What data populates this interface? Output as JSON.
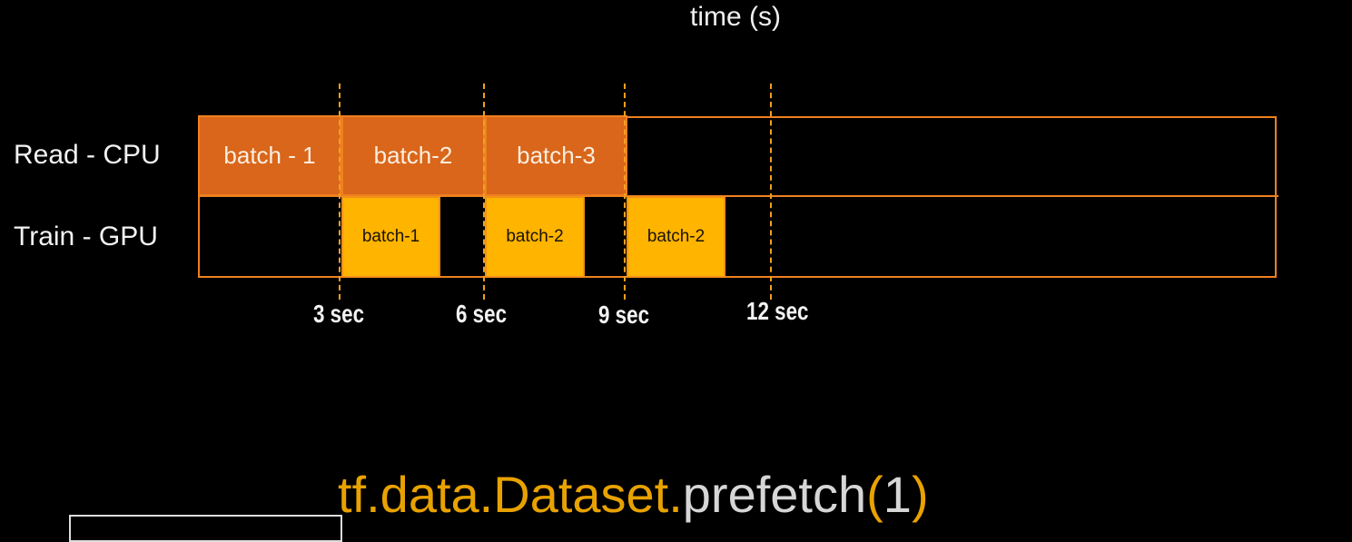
{
  "axis_title": "time (s)",
  "rows": [
    {
      "label": "Read - CPU",
      "blocks": [
        "batch - 1",
        "batch-2",
        "batch-3"
      ]
    },
    {
      "label": "Train - GPU",
      "blocks": [
        "batch-1",
        "batch-2",
        "batch-2"
      ]
    }
  ],
  "ticks": [
    "3 sec",
    "6 sec",
    "9 sec",
    "12 sec"
  ],
  "code": {
    "part1": "tf.data.Dataset.",
    "part2": "prefetch",
    "open": "(",
    "arg": "1",
    "close": ")"
  },
  "colors": {
    "read": "#d9661a",
    "train": "#ffb400",
    "border": "#f0801f",
    "code_accent": "#e8a200"
  }
}
